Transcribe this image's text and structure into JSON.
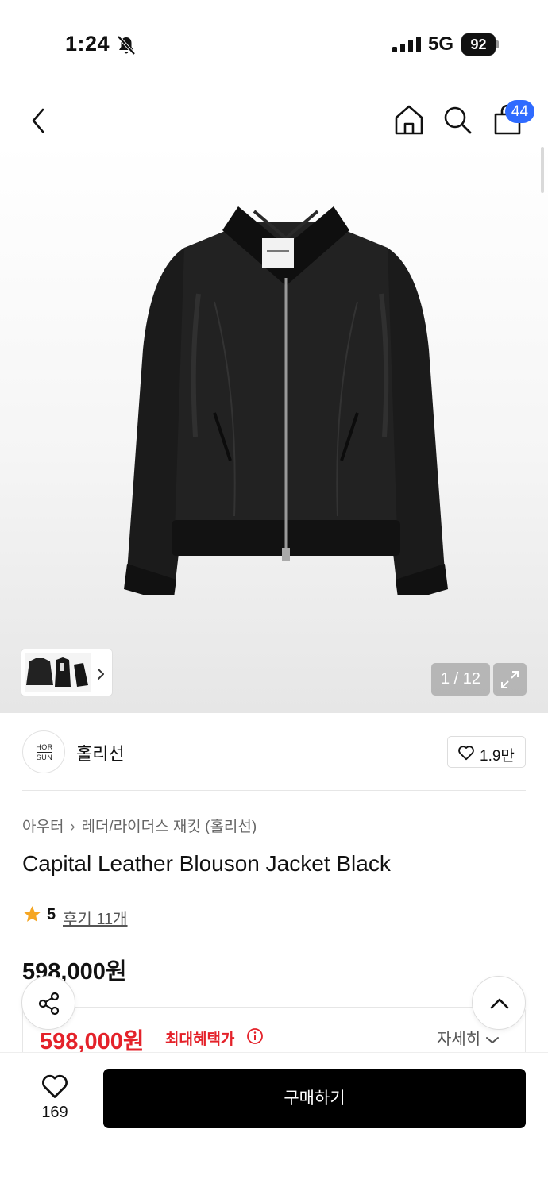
{
  "status_bar": {
    "time": "1:24",
    "network": "5G",
    "battery": "92"
  },
  "nav": {
    "cart_count": "44"
  },
  "gallery": {
    "counter": "1 / 12"
  },
  "brand": {
    "name": "홀리선",
    "logo_line1": "HOR",
    "logo_line2": "SUN",
    "like_count": "1.9만"
  },
  "breadcrumb": {
    "category": "아우터",
    "subcategory": "레더/라이더스 재킷 (홀리선)"
  },
  "product": {
    "title": "Capital Leather Blouson Jacket Black",
    "rating": "5",
    "review_link": "후기 11개",
    "price": "598,000원"
  },
  "benefit": {
    "price": "598,000원",
    "label": "최대혜택가",
    "detail_label": "자세히"
  },
  "bottom_bar": {
    "like_count": "169",
    "buy_label": "구매하기"
  },
  "colors": {
    "accent_red": "#e4222a",
    "badge_blue": "#2f6bff",
    "button_black": "#000000",
    "rating_star": "#f5a623"
  },
  "icons": [
    "bell-slash-icon",
    "signal-icon",
    "battery-icon",
    "back-icon",
    "home-icon",
    "search-icon",
    "shopping-bag-icon",
    "chevron-right-icon",
    "expand-icon",
    "heart-icon",
    "star-icon",
    "info-icon",
    "chevron-down-icon",
    "share-icon",
    "chevron-up-icon"
  ]
}
